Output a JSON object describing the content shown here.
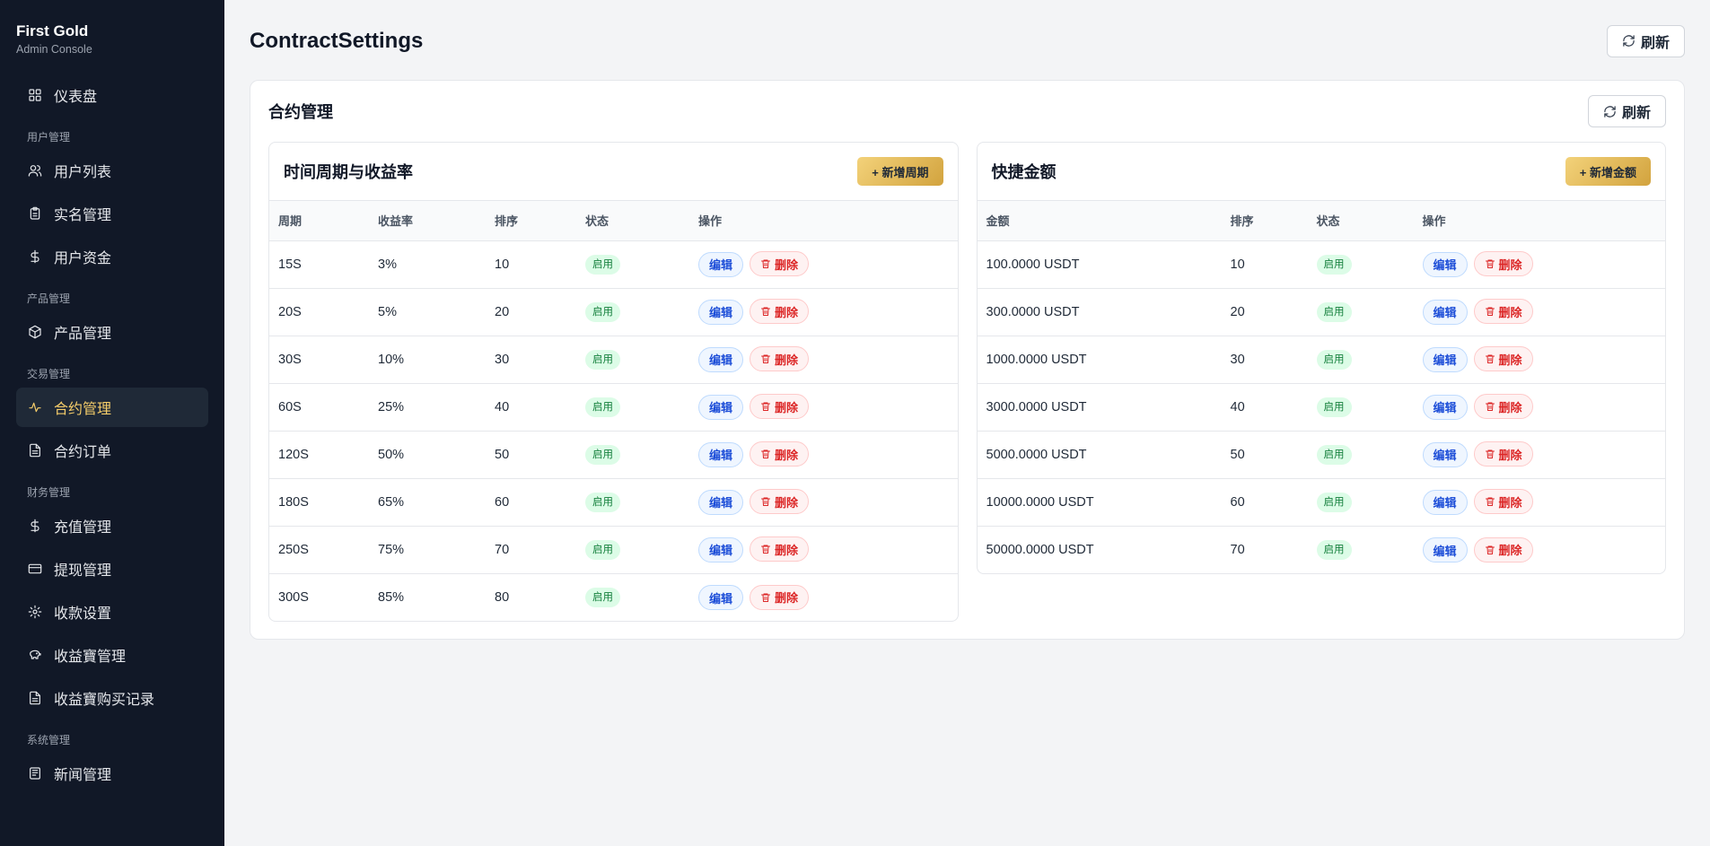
{
  "brand": {
    "title": "First Gold",
    "subtitle": "Admin Console"
  },
  "sidebar": {
    "dashboard": "仪表盘",
    "groups": {
      "users": "用户管理",
      "products": "产品管理",
      "trading": "交易管理",
      "finance": "财务管理",
      "system": "系统管理"
    },
    "items": {
      "user_list": "用户列表",
      "kyc": "实名管理",
      "user_funds": "用户资金",
      "product_mgmt": "产品管理",
      "contract_mgmt": "合约管理",
      "contract_orders": "合约订单",
      "deposit_mgmt": "充值管理",
      "withdraw_mgmt": "提现管理",
      "payment_settings": "收款设置",
      "yield_mgmt": "收益寶管理",
      "yield_records": "收益寶购买记录",
      "news_mgmt": "新闻管理"
    },
    "active": "contract_mgmt",
    "active_color": "#f5cd6a",
    "bg_color": "#111827"
  },
  "header": {
    "title": "ContractSettings",
    "refresh_label": "刷新"
  },
  "card": {
    "title": "合约管理",
    "refresh_label": "刷新"
  },
  "periods": {
    "title": "时间周期与收益率",
    "add_label": "+ 新增周期",
    "columns": {
      "period": "周期",
      "rate": "收益率",
      "sort": "排序",
      "status": "状态",
      "actions": "操作"
    },
    "rows": [
      {
        "period": "15S",
        "rate": "3%",
        "sort": "10",
        "status": "启用"
      },
      {
        "period": "20S",
        "rate": "5%",
        "sort": "20",
        "status": "启用"
      },
      {
        "period": "30S",
        "rate": "10%",
        "sort": "30",
        "status": "启用"
      },
      {
        "period": "60S",
        "rate": "25%",
        "sort": "40",
        "status": "启用"
      },
      {
        "period": "120S",
        "rate": "50%",
        "sort": "50",
        "status": "启用"
      },
      {
        "period": "180S",
        "rate": "65%",
        "sort": "60",
        "status": "启用"
      },
      {
        "period": "250S",
        "rate": "75%",
        "sort": "70",
        "status": "启用"
      },
      {
        "period": "300S",
        "rate": "85%",
        "sort": "80",
        "status": "启用"
      }
    ]
  },
  "amounts": {
    "title": "快捷金额",
    "add_label": "+ 新增金额",
    "columns": {
      "amount": "金额",
      "sort": "排序",
      "status": "状态",
      "actions": "操作"
    },
    "rows": [
      {
        "amount": "100.0000 USDT",
        "sort": "10",
        "status": "启用"
      },
      {
        "amount": "300.0000 USDT",
        "sort": "20",
        "status": "启用"
      },
      {
        "amount": "1000.0000 USDT",
        "sort": "30",
        "status": "启用"
      },
      {
        "amount": "3000.0000 USDT",
        "sort": "40",
        "status": "启用"
      },
      {
        "amount": "5000.0000 USDT",
        "sort": "50",
        "status": "启用"
      },
      {
        "amount": "10000.0000 USDT",
        "sort": "60",
        "status": "启用"
      },
      {
        "amount": "50000.0000 USDT",
        "sort": "70",
        "status": "启用"
      }
    ]
  },
  "actions": {
    "edit": "编辑",
    "delete": "删除"
  },
  "colors": {
    "gold_start": "#f3d27a",
    "gold_end": "#d2a33e",
    "enabled_bg": "#dcfce7",
    "enabled_text": "#15803d"
  }
}
